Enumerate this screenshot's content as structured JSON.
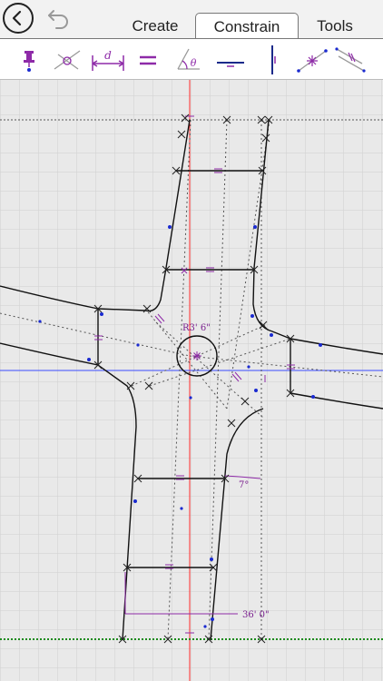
{
  "tabs": [
    {
      "label": "Create",
      "active": false
    },
    {
      "label": "Constrain",
      "active": true
    },
    {
      "label": "Tools",
      "active": false
    }
  ],
  "toolbar": {
    "tools": [
      "pin-icon",
      "point-on-line-icon",
      "distance-icon",
      "equal-icon",
      "angle-icon",
      "horizontal-icon",
      "vertical-icon",
      "midpoint-icon",
      "parallel-icon"
    ],
    "distance_label": "d",
    "angle_label": "θ"
  },
  "drawing": {
    "radius_label": "R3' 6\"",
    "angle_label": "7°",
    "length_label": "36' 0\"",
    "colors": {
      "accent": "#8e2aa8",
      "constraint": "#7a1f8f",
      "red_axis": "#ff2a2a",
      "blue_axis": "#3a4cff",
      "ground_line": "#1a8a1a",
      "point": "#1a2ad0"
    }
  }
}
